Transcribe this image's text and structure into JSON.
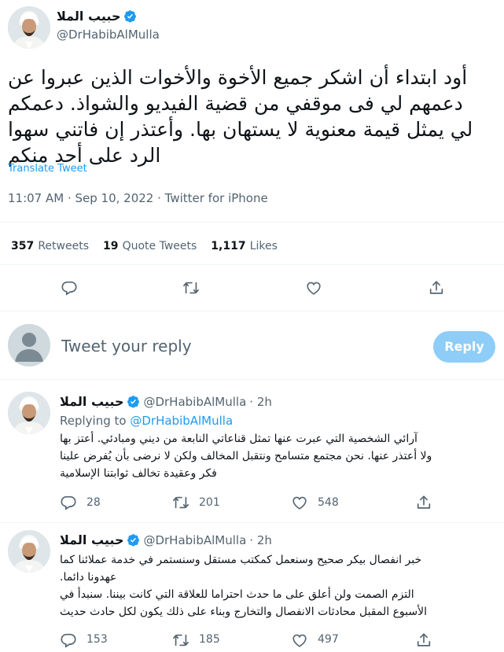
{
  "tweet": {
    "display_name": "حبيب الملا",
    "handle": "@DrHabibAlMulla",
    "text_lines": [
      "أود ابتداء أن اشكر جميع الأخوة والأخوات الذين عبروا عن",
      "دعمهم لي فى موقفي من قضية الفيديو والشواذ. دعمكم",
      "لي يمثل قيمة معنوية لا يستهان بها. وأعتذر إن فاتني سهوا",
      "الرد على أحد منكم"
    ],
    "translate_label": "Translate Tweet",
    "timestamp": "11:07 AM · Sep 10, 2022 · Twitter for iPhone",
    "stats": {
      "retweets_count": "357",
      "retweets_label": "Retweets",
      "quotes_count": "19",
      "quotes_label": "Quote Tweets",
      "likes_count": "1,117",
      "likes_label": "Likes"
    }
  },
  "compose": {
    "placeholder": "Tweet your reply",
    "reply_button": "Reply"
  },
  "replies": [
    {
      "display_name": "حبيب الملا",
      "handle": "@DrHabibAlMulla",
      "time": "· 2h",
      "replying_prefix": "Replying to",
      "replying_to": "@DrHabibAlMulla",
      "text_lines": [
        "آرائي الشخصية التي عبرت عنها تمثل قناعاتي النابعة من ديني ومبادئي. أعتز بها",
        "ولا أعتذر عنها. نحن مجتمع متسامح ونتقبل المخالف ولكن لا نرضى بأن يُفرض علينا",
        "فكر وعقيدة تخالف ثوابتنا الإسلامية"
      ],
      "reply_count": "28",
      "retweet_count": "201",
      "like_count": "548"
    },
    {
      "display_name": "حبيب الملا",
      "handle": "@DrHabibAlMulla",
      "time": "· 2h",
      "text_lines": [
        "خبر انفصال بيكر صحيح وسنعمل كمكتب مستقل وسنستمر في خدمة عملائنا كما",
        "عهدونا دائما.",
        "التزم الصمت ولن أعلق على ما حدث احتراما للعلاقة التي كانت بيننا. سنبدأ في",
        "الأسبوع المقبل محادثات الانفصال والتخارج وبناء على ذلك يكون لكل حادث حديث"
      ],
      "reply_count": "153",
      "retweet_count": "185",
      "like_count": "497"
    }
  ],
  "icons": {
    "verified": "verified-badge-icon",
    "reply": "reply-icon",
    "retweet": "retweet-icon",
    "like": "heart-icon",
    "share": "share-icon",
    "placeholder_avatar": "default-avatar-icon"
  },
  "colors": {
    "accent": "#1d9bf0",
    "muted": "#536471",
    "reply_button_disabled": "#8ecdf7"
  }
}
